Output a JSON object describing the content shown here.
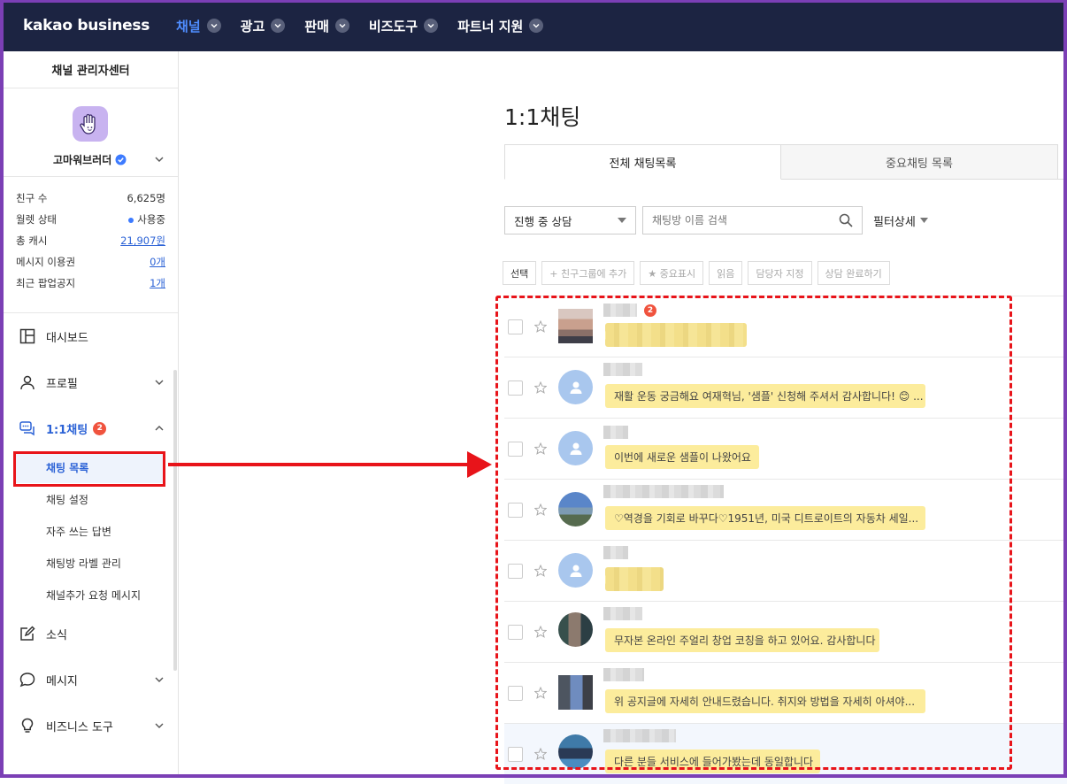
{
  "topnav": {
    "logo": "kakao business",
    "items": [
      {
        "label": "채널",
        "active": true
      },
      {
        "label": "광고"
      },
      {
        "label": "판매"
      },
      {
        "label": "비즈도구"
      },
      {
        "label": "파트너 지원"
      }
    ]
  },
  "sidebar": {
    "title": "채널 관리자센터",
    "channel_name": "고마워브러더",
    "stats": [
      {
        "label": "친구 수",
        "value": "6,625명"
      },
      {
        "label": "월렛 상태",
        "value": "사용중"
      },
      {
        "label": "총 캐시",
        "value": "21,907원"
      },
      {
        "label": "메시지 이용권",
        "value": "0개"
      },
      {
        "label": "최근 팝업공지",
        "value": "1개"
      }
    ],
    "menu": {
      "dashboard": "대시보드",
      "profile": "프로필",
      "chat": "1:1채팅",
      "chat_badge": "2",
      "news": "소식",
      "message": "메시지",
      "biz_tools": "비즈니스 도구"
    },
    "chat_submenu": [
      "채팅 목록",
      "채팅 설정",
      "자주 쓰는 답변",
      "채팅방 라벨 관리",
      "채널추가 요청 메시지"
    ]
  },
  "main": {
    "title": "1:1채팅",
    "tabs": [
      "전체 채팅목록",
      "중요채팅 목록"
    ],
    "status_select": "진행 중 상담",
    "search_placeholder": "채팅방 이름 검색",
    "filter_detail": "필터상세",
    "actions": [
      "선택",
      "+ 친구그룹에 추가",
      "★ 중요표시",
      "읽음",
      "담당자 지정",
      "상담 완료하기"
    ],
    "chats": [
      {
        "message": "",
        "unread": "2"
      },
      {
        "message": "재활 운동 궁금해요 여재혁님, '샘플' 신청해 주셔서 감사합니다! 😊 ..."
      },
      {
        "message": "이번에 새로운 샘플이 나왔어요"
      },
      {
        "message": "♡역경을 기회로 바꾸다♡1951년, 미국 디트로이트의 자동차 세일..."
      },
      {
        "message": ""
      },
      {
        "message": "무자본 온라인 주얼리 창업 코칭을 하고 있어요. 감사합니다"
      },
      {
        "message": "위 공지글에 자세히 안내드렸습니다. 취지와 방법을 자세히 아셔야..."
      },
      {
        "message": "다른 분들 서비스에 들어가봤는데 동일합니다"
      }
    ]
  },
  "colors": {
    "nav_bg": "#1c2442",
    "accent": "#2b62d6",
    "bubble": "#fcec9c",
    "annotation_red": "#e8141a",
    "frame": "#7b3fb5"
  }
}
